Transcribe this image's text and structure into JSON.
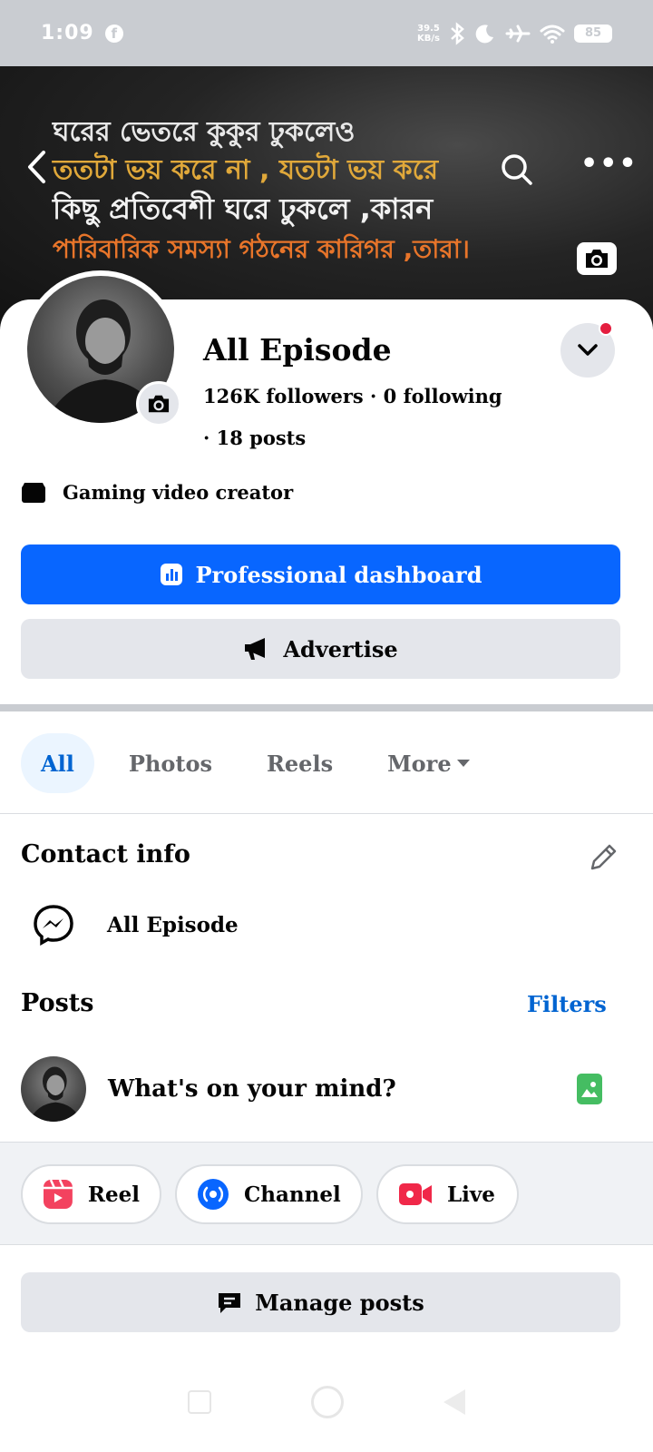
{
  "status_bar": {
    "time": "1:09",
    "app_icon": "facebook-icon",
    "net_speed_value": "39.5",
    "net_speed_unit": "KB/s",
    "battery": "85",
    "icons": [
      "bluetooth-icon",
      "moon-icon",
      "airplane-icon",
      "wifi-icon",
      "battery-icon"
    ]
  },
  "cover": {
    "lines": [
      "ঘরের ভেতরে কুকুর ঢুকলেও",
      "ততটা ভয় করে না , যতটা ভয় করে",
      "কিছু প্রতিবেশী ঘরে ঢুকলে ,কারন",
      "পারিবারিক সমস্যা গঠনের কারিগর ,তারা।"
    ],
    "more_label": "•••"
  },
  "profile": {
    "name": "All Episode",
    "stats": "126K followers · 0 following",
    "posts": "· 18 posts",
    "bio": "Gaming video creator"
  },
  "buttons": {
    "dashboard": "Professional dashboard",
    "advertise": "Advertise",
    "manage_posts": "Manage posts"
  },
  "tabs": [
    {
      "label": "All",
      "active": true
    },
    {
      "label": "Photos",
      "active": false
    },
    {
      "label": "Reels",
      "active": false
    },
    {
      "label": "More",
      "active": false
    }
  ],
  "contact": {
    "title": "Contact info",
    "messenger_name": "All Episode"
  },
  "posts": {
    "title": "Posts",
    "filters": "Filters",
    "composer_placeholder": "What's on your mind?"
  },
  "create_options": [
    {
      "label": "Reel",
      "icon": "reel-icon",
      "color": "#f3425f"
    },
    {
      "label": "Channel",
      "icon": "channel-icon",
      "color": "#0866ff"
    },
    {
      "label": "Live",
      "icon": "live-video-icon",
      "color": "#f02849"
    }
  ],
  "colors": {
    "primary": "#0866ff",
    "link": "#0064d1",
    "secondary_bg": "#e4e6eb",
    "notification": "#e41e3f",
    "photo_green": "#45bd62"
  }
}
